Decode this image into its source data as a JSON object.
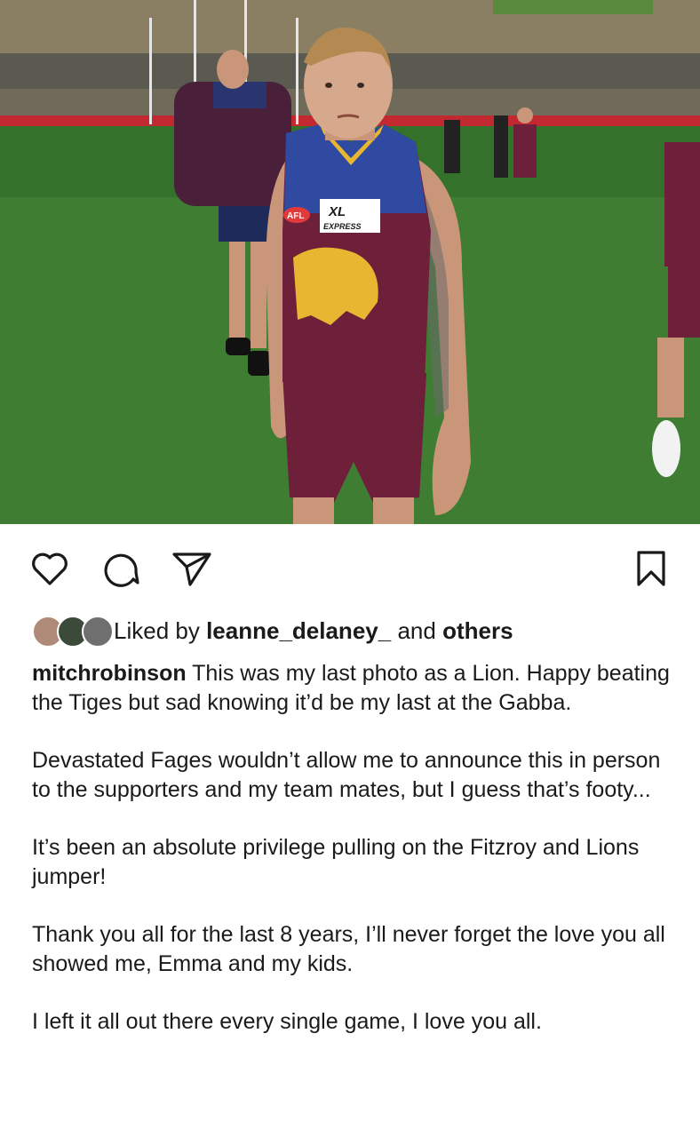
{
  "post": {
    "image_alt_subject": "afl-player-photo",
    "jersey_text": {
      "sponsor_top": "XL",
      "sponsor_bottom": "EXPRESS",
      "league_badge": "AFL"
    },
    "actions": {
      "like_icon": "heart-icon",
      "comment_icon": "comment-icon",
      "share_icon": "send-icon",
      "save_icon": "bookmark-icon"
    },
    "likes": {
      "prefix": "Liked by",
      "user": "leanne_delaney_",
      "and": "and",
      "others": "others"
    },
    "caption": {
      "username": "mitchrobinson",
      "first": "This was my last photo as a Lion. Happy beating the Tiges but sad knowing it’d be my last at the Gabba.",
      "paragraphs": [
        "Devastated Fages wouldn’t allow me to announce this in person to the supporters and my team mates, but I guess that’s footy...",
        "It’s been an absolute privilege pulling on the Fitzroy and Lions jumper!",
        "Thank you all for the last 8 years, I’ll never forget the love you all showed me, Emma and my kids.",
        "I left it all out there every single game, I love you all."
      ]
    }
  },
  "colors": {
    "maroon": "#6e1f3a",
    "blue": "#2f4aa0",
    "gold": "#e8b631",
    "grass": "#3e7d32"
  }
}
